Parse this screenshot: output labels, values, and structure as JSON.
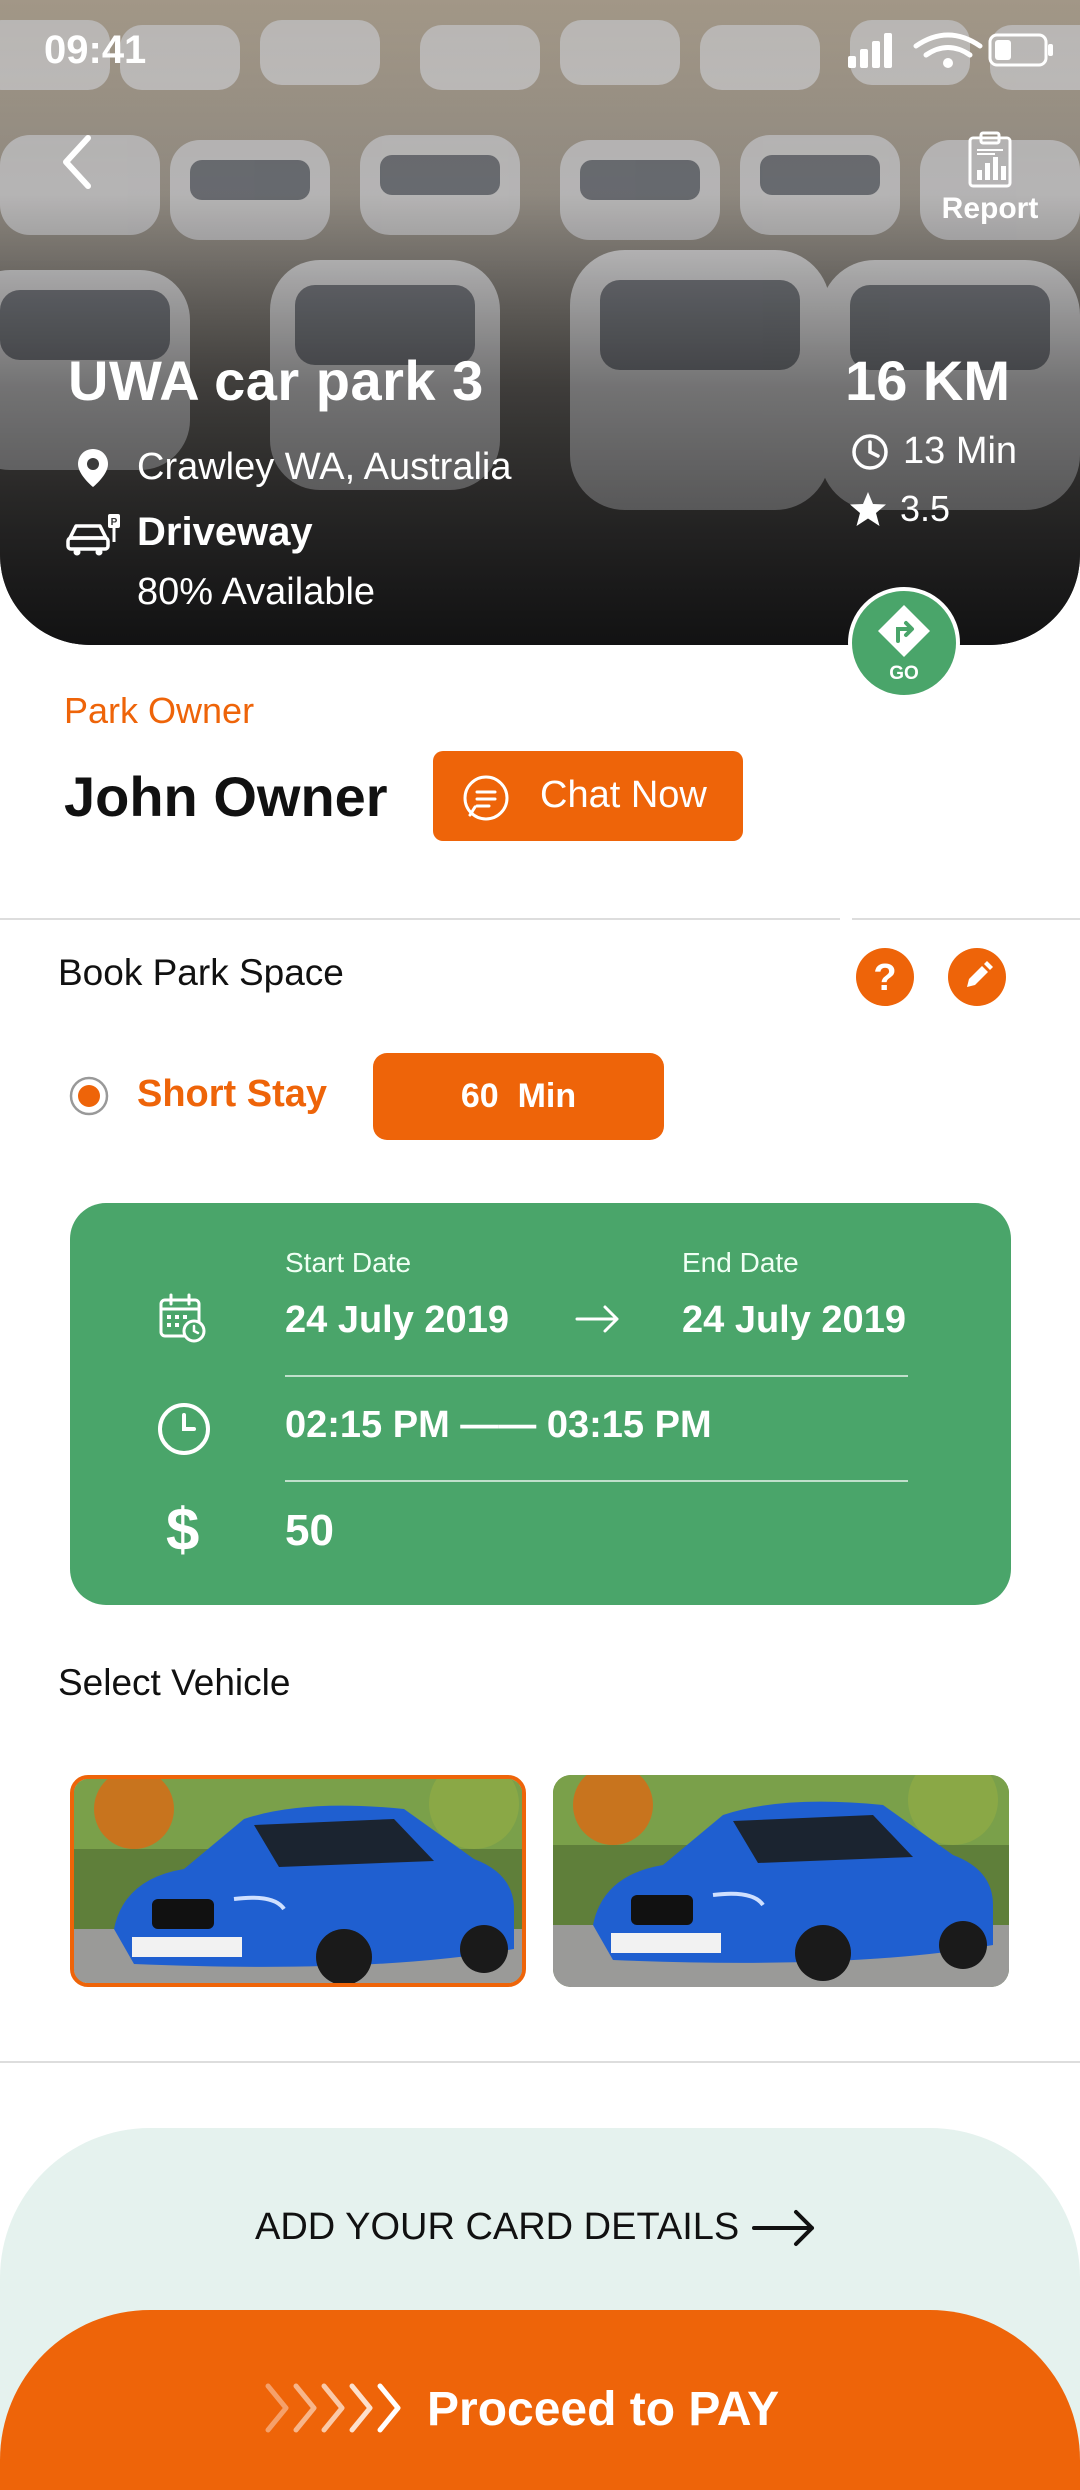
{
  "status_bar": {
    "time": "09:41"
  },
  "header": {
    "back_icon": "chevron-left-icon",
    "report_label": "Report",
    "report_icon": "clipboard-chart-icon"
  },
  "park": {
    "name": "UWA car park 3",
    "location": "Crawley WA, Australia",
    "type": "Driveway",
    "availability": "80% Available",
    "distance": "16 KM",
    "time": "13 Min",
    "rating": "3.5",
    "go_label": "GO"
  },
  "owner": {
    "label": "Park Owner",
    "name": "John Owner",
    "chat_label": "Chat Now"
  },
  "booking": {
    "title": "Book Park Space",
    "stay_option": "Short Stay",
    "duration": "60  Min",
    "start_label": "Start Date",
    "start_date": "24 July 2019",
    "end_label": "End Date",
    "end_date": "24 July 2019",
    "time_range": "02:15 PM —— 03:15 PM",
    "currency_symbol": "$",
    "price": "50"
  },
  "vehicles": {
    "title": "Select Vehicle",
    "selected_index": 0
  },
  "footer": {
    "add_card_label": "ADD YOUR CARD DETAILS",
    "pay_label": "Proceed to PAY"
  },
  "colors": {
    "accent": "#ee6409",
    "green": "#4aa56a",
    "card_bg": "#e5f2ee"
  }
}
